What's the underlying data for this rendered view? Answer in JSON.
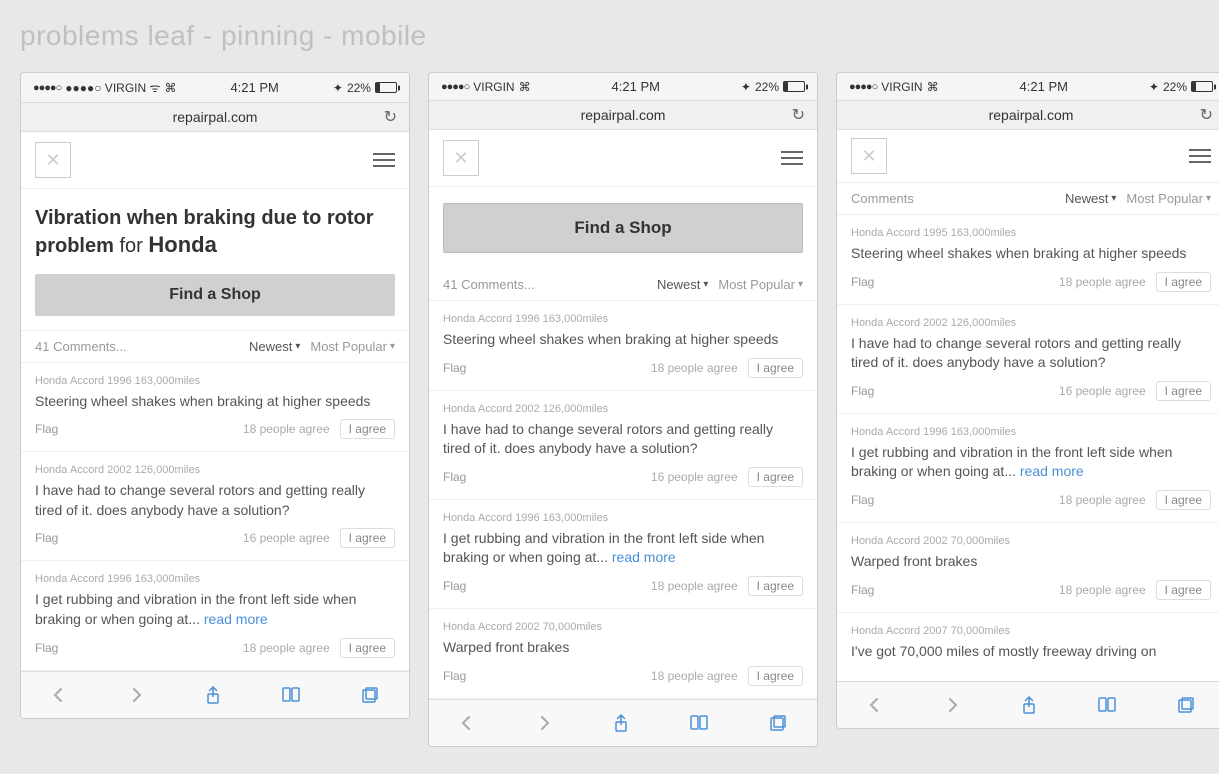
{
  "pageTitle": "problems leaf - pinning - mobile",
  "screens": [
    {
      "id": "screen1",
      "statusBar": {
        "left": "●●●●○ VIRGIN  ᯤ",
        "center": "4:21 PM",
        "right": "✦ 22%"
      },
      "browserUrl": "repairpal.com",
      "heroTitle1": "Vibration when braking due to rotor problem",
      "heroTitleFor": "for",
      "heroTitleBrand": "Honda",
      "findShopLabel": "Find a Shop",
      "commentsCount": "41 Comments...",
      "sortNewest": "Newest",
      "sortMostPopular": "Most Popular",
      "comments": [
        {
          "meta": "Honda Accord 1996   163,000miles",
          "text": "Steering wheel shakes when braking at higher speeds",
          "flag": "Flag",
          "agreeCount": "18 people agree",
          "agreeBtn": "I agree"
        },
        {
          "meta": "Honda Accord 2002   126,000miles",
          "text": "I have had to change several rotors and getting really tired of it. does anybody have a solution?",
          "flag": "Flag",
          "agreeCount": "16 people agree",
          "agreeBtn": "I agree"
        },
        {
          "meta": "Honda Accord 1996   163,000miles",
          "text": "I get rubbing and vibration in the front left side when braking or when going at...",
          "textLink": "read more",
          "flag": "Flag",
          "agreeCount": "18 people agree",
          "agreeBtn": "I agree"
        }
      ]
    },
    {
      "id": "screen2",
      "statusBar": {
        "left": "●●●●○ VIRGIN  ᯤ",
        "center": "4:21 PM",
        "right": "✦ 22%"
      },
      "browserUrl": "repairpal.com",
      "findShopLabel": "Find a Shop",
      "commentsCount": "41 Comments...",
      "sortNewest": "Newest",
      "sortMostPopular": "Most Popular",
      "comments": [
        {
          "meta": "Honda Accord 1996   163,000miles",
          "text": "Steering wheel shakes when braking at higher speeds",
          "flag": "Flag",
          "agreeCount": "18 people agree",
          "agreeBtn": "I agree"
        },
        {
          "meta": "Honda Accord 2002   126,000miles",
          "text": "I have had to change several rotors and getting really tired of it. does anybody have a solution?",
          "flag": "Flag",
          "agreeCount": "16 people agree",
          "agreeBtn": "I agree"
        },
        {
          "meta": "Honda Accord 1996   163,000miles",
          "text": "I get rubbing and vibration in the front left side when braking or when going at...",
          "textLink": "read more",
          "flag": "Flag",
          "agreeCount": "18 people agree",
          "agreeBtn": "I agree"
        },
        {
          "meta": "Honda Accord 2002   70,000miles",
          "text": "Warped front brakes",
          "flag": "Flag",
          "agreeCount": "18 people agree",
          "agreeBtn": "I agree"
        }
      ]
    },
    {
      "id": "screen3",
      "statusBar": {
        "left": "●●●●○ VIRGIN  ᯤ",
        "center": "4:21 PM",
        "right": "✦ 22%"
      },
      "browserUrl": "repairpal.com",
      "commentsCount": "Comments",
      "sortNewest": "Newest",
      "sortMostPopular": "Most Popular",
      "comments": [
        {
          "meta": "Honda Accord 1995   163,000miles",
          "text": "Steering wheel shakes when braking at higher speeds",
          "flag": "Flag",
          "agreeCount": "18 people agree",
          "agreeBtn": "I agree"
        },
        {
          "meta": "Honda Accord 2002   126,000miles",
          "text": "I have had to change several rotors and getting really tired of it. does anybody have a solution?",
          "flag": "Flag",
          "agreeCount": "16 people agree",
          "agreeBtn": "I agree"
        },
        {
          "meta": "Honda Accord 1996   163,000miles",
          "text": "I get rubbing and vibration in the front left side when braking or when going at...",
          "textLink": "read more",
          "flag": "Flag",
          "agreeCount": "18 people agree",
          "agreeBtn": "I agree"
        },
        {
          "meta": "Honda Accord 2002   70,000miles",
          "text": "Warped front brakes",
          "flag": "Flag",
          "agreeCount": "18 people agree",
          "agreeBtn": "I agree"
        },
        {
          "meta": "Honda Accord 2007   70,000miles",
          "text": "I've got 70,000 miles of mostly freeway driving on",
          "flag": "",
          "agreeCount": "",
          "agreeBtn": ""
        }
      ]
    }
  ],
  "bottomNav": {
    "back": "‹",
    "forward": "›",
    "share": "⬆",
    "bookmarks": "📖",
    "tabs": "⧉"
  }
}
